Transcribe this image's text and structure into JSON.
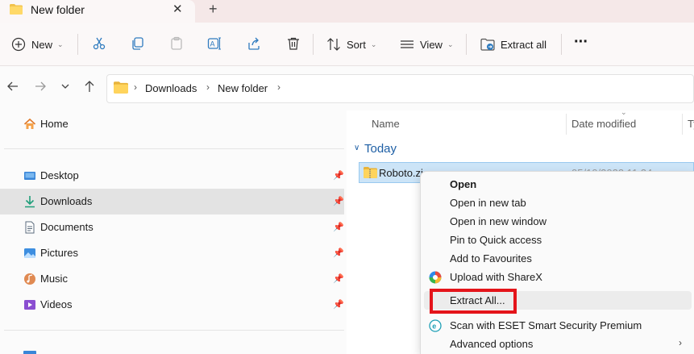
{
  "window": {
    "tab_title": "New folder",
    "tab_close_glyph": "✕",
    "new_tab_glyph": "+"
  },
  "toolbar": {
    "new_label": "New",
    "sort_label": "Sort",
    "view_label": "View",
    "extract_all_label": "Extract all",
    "more_glyph": "···",
    "icons": [
      "plus-icon",
      "cut-icon",
      "copy-icon",
      "paste-icon",
      "rename-icon",
      "share-icon",
      "delete-icon",
      "sort-icon",
      "view-icon",
      "extract-icon",
      "more-icon"
    ]
  },
  "address": {
    "crumbs": [
      "Downloads",
      "New folder"
    ]
  },
  "nav": {
    "home": "Home",
    "items": [
      {
        "label": "Desktop",
        "icon": "desktop-icon",
        "pinned": true
      },
      {
        "label": "Downloads",
        "icon": "download-icon",
        "pinned": true,
        "active": true
      },
      {
        "label": "Documents",
        "icon": "documents-icon",
        "pinned": true
      },
      {
        "label": "Pictures",
        "icon": "pictures-icon",
        "pinned": true
      },
      {
        "label": "Music",
        "icon": "music-icon",
        "pinned": true
      },
      {
        "label": "Videos",
        "icon": "videos-icon",
        "pinned": true
      }
    ]
  },
  "content": {
    "columns": [
      "Name",
      "Date modified",
      "Ty"
    ],
    "group": "Today",
    "file": {
      "name": "Roboto.zi",
      "date": "05/10/2023 11:24"
    }
  },
  "context_menu": {
    "items": [
      {
        "label": "Open",
        "bold": true
      },
      {
        "label": "Open in new tab"
      },
      {
        "label": "Open in new window"
      },
      {
        "label": "Pin to Quick access"
      },
      {
        "label": "Add to Favourites"
      },
      {
        "label": "Upload with ShareX",
        "icon": "sharex-icon"
      },
      {
        "label": "Extract All...",
        "highlighted": true
      },
      {
        "label": "Scan with ESET Smart Security Premium",
        "icon": "eset-icon"
      },
      {
        "label": "Advanced options",
        "submenu": true
      }
    ]
  },
  "colors": {
    "accent": "#1e5fa5",
    "selection": "#cce4f7",
    "annotation_red": "#e4141a"
  }
}
